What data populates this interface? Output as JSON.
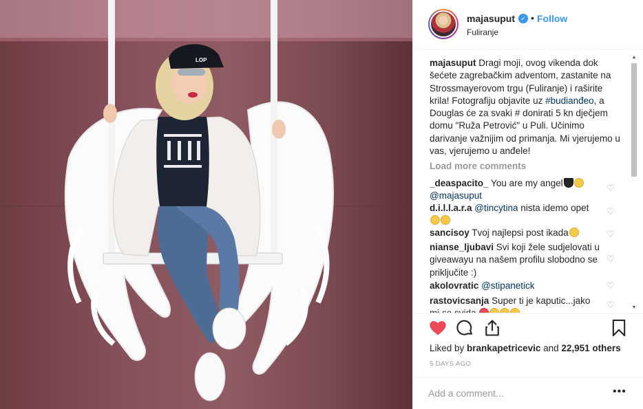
{
  "post": {
    "username": "majasuput",
    "verified_mark": "✓",
    "separator": "•",
    "follow_label": "Follow",
    "location": "Fuliranje"
  },
  "caption": {
    "username": "majasuput",
    "text_1": " Dragi moji, ovog vikenda dok šećete zagrebačkim adventom, zastanite na Strossmayerovom trgu (Fuliranje) i raširite krila! Fotografiju objavite uz ",
    "hashtag": "#budianđeo",
    "text_2": ", a Douglas će za svaki # donirati 5 kn dječjem domu \"Ruža Petrović\" u Puli. Učinimo darivanje važnijim od primanja. Mi vjerujemo u vas, vjerujemo u anđele!"
  },
  "load_more_label": "Load more comments",
  "comments": [
    {
      "username": "_deaspacito_",
      "text": " You are my angel",
      "mention": "@majasuput"
    },
    {
      "username": "d.i.l.l.a.r.a",
      "mention": "@tincytina",
      "text": " nista idemo opet"
    },
    {
      "username": "sancisoy",
      "text": " Tvoj najlepsi post ikada"
    },
    {
      "username": "nianse_ljubavi",
      "text": " Svi koji žele sudjelovati u giveawayu na našem profilu slobodno se priključite :)"
    },
    {
      "username": "akolovratic",
      "mention": "@stipanetick"
    },
    {
      "username": "rastovicsanja",
      "text": " Super ti je kaputic...jako mi se svida "
    }
  ],
  "likes": {
    "prefix": "Liked by ",
    "user": "brankapetricevic",
    "middle": " and ",
    "count": "22,951 others"
  },
  "age": "5 DAYS AGO",
  "add_comment": {
    "placeholder": "Add a comment..."
  },
  "more_options": "•••",
  "colors": {
    "accent_blue": "#3897f0",
    "liked_red": "#ed4956",
    "muted_gray": "#999999",
    "hashtag_blue": "#003569"
  },
  "icons": {
    "like": "heart-icon",
    "comment": "comment-icon",
    "share": "share-icon",
    "save": "bookmark-icon"
  }
}
